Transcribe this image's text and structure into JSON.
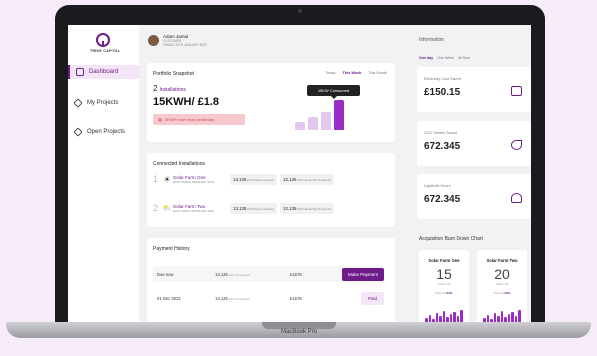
{
  "brand": {
    "name": "TRIKE CAPITAL",
    "accent": "#6e1b8a",
    "device_label": "MacBook Pro"
  },
  "sidebar": {
    "items": [
      {
        "label": "Dashboard",
        "icon": "home-icon",
        "active": true
      },
      {
        "label": "My Projects",
        "icon": "cube-icon",
        "active": false
      },
      {
        "label": "Open Projects",
        "icon": "cube-icon",
        "active": false
      }
    ]
  },
  "user": {
    "name": "Adam Jamal",
    "role": "CUSTOMER",
    "date": "FRIDAY 30TH JANUARY 2023"
  },
  "snapshot": {
    "title": "Portfolio Snapshot",
    "tabs": [
      "Today",
      "This Week",
      "This Month"
    ],
    "active_tab": "This Week",
    "installations_count": "2",
    "installations_label": "Installations",
    "headline": "15KWH/ £1.8",
    "change_text": "3KWH more than yesterday",
    "tooltip": "15KW Consumed",
    "bars": [
      0.25,
      0.4,
      0.55,
      0.95
    ],
    "highlight_bar": 3
  },
  "connected": {
    "title": "Connected Installations",
    "rows": [
      {
        "index": "1",
        "icon": "sun-icon",
        "name": "Solar Farm One",
        "location": "EAST AFRICA SINCE MAY 2019",
        "capacity_value": "13,135",
        "capacity_label": "KW Power Capacity",
        "produced_value": "13,135",
        "produced_label": "KWh Electricity Produced"
      },
      {
        "index": "2",
        "icon": "sun-cloud-icon",
        "name": "Solar Farm Two",
        "location": "EAST AFRICA SINCE MAY 2019",
        "capacity_value": "13,135",
        "capacity_label": "KW Power Capacity",
        "produced_value": "13,135",
        "produced_label": "KWh Electricity Produced"
      }
    ]
  },
  "payments": {
    "title": "Payment History",
    "rows": [
      {
        "when": "Due now",
        "consumed_value": "13,135",
        "consumed_label": "KW Consumed",
        "amount": "£1576",
        "action": "Make Payment",
        "action_type": "pay"
      },
      {
        "when": "01 Dec 2022",
        "consumed_value": "13,135",
        "consumed_label": "KW Consumed",
        "amount": "£1576",
        "action": "Paid",
        "action_type": "paid"
      }
    ]
  },
  "information": {
    "title": "Information",
    "tabs": [
      "One day",
      "One Week",
      "All time"
    ],
    "active_tab": "One day",
    "metrics": [
      {
        "label": "Electricity Cost Saved",
        "value": "£150.15",
        "icon": "wallet-icon"
      },
      {
        "label": "CO2 Tonnes Saved",
        "value": "672.345",
        "icon": "leaf-icon"
      },
      {
        "label": "Lightbulb Hours",
        "value": "672.345",
        "icon": "lightbulb-icon"
      }
    ]
  },
  "burndown": {
    "title": "Acquisition Burn Down Chart",
    "farms": [
      {
        "name": "Solar Farm One",
        "number": "15",
        "unit": "Years Left",
        "percent_prefix": "Paid off",
        "percent": "63%"
      },
      {
        "name": "Solar Farm Two",
        "number": "20",
        "unit": "Years Left",
        "percent_prefix": "Paid off",
        "percent": "63%"
      }
    ]
  }
}
